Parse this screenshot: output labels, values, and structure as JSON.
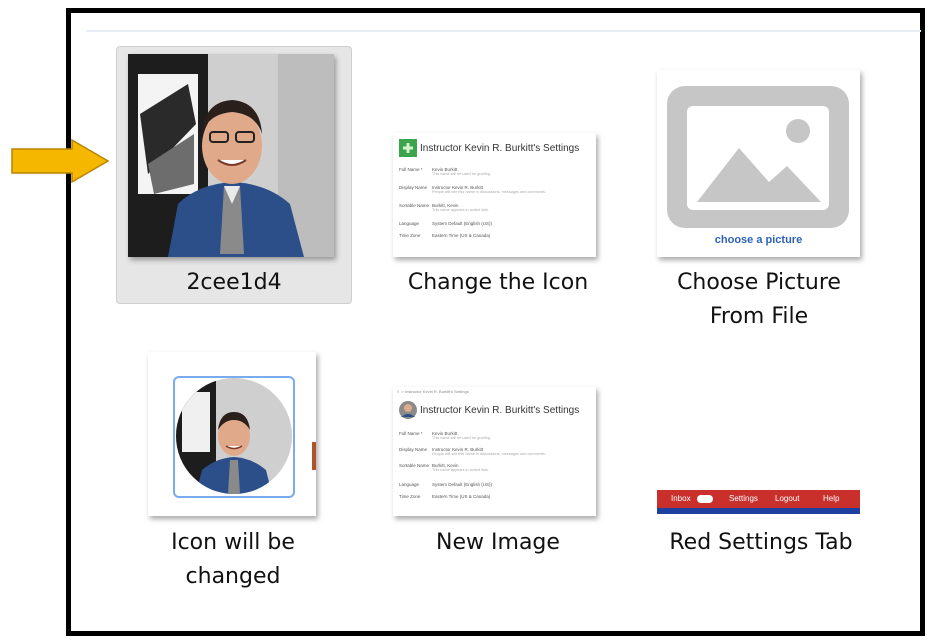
{
  "items": [
    {
      "caption": "2cee1d4"
    },
    {
      "caption": "Change the Icon"
    },
    {
      "caption_line1": "Choose Picture",
      "caption_line2": "From File"
    },
    {
      "caption_line1": "Icon will be",
      "caption_line2": "changed"
    },
    {
      "caption": "New Image"
    },
    {
      "caption": "Red Settings Tab"
    }
  ],
  "settings_preview": {
    "title": "Instructor Kevin R. Burkitt's Settings",
    "rows": [
      {
        "label": "Full Name *",
        "value": "Kevin Burkitt",
        "sub": "This name will be used for grading."
      },
      {
        "label": "Display Name",
        "value": "Instructor Kevin R. Burkitt",
        "sub": "People will see this name in discussions, messages and comments."
      },
      {
        "label": "Sortable Name",
        "value": "Burkitt, Kevin",
        "sub": "This name appears in sorted lists."
      },
      {
        "label": "Language",
        "value": "System Default (English (US))",
        "sub": ""
      },
      {
        "label": "Time Zone",
        "value": "Eastern Time (US & Canada)",
        "sub": ""
      }
    ],
    "breadcrumb": "Instructor Kevin R. Burkitt's Settings"
  },
  "choose_picture": {
    "label": "choose a picture"
  },
  "red_tab": {
    "items": [
      "Inbox",
      "Settings",
      "Logout",
      "Help"
    ]
  },
  "colors": {
    "accent_arrow": "#f5b700",
    "red_tab": "#c9302c",
    "blue_bar": "#1c3fa0"
  }
}
